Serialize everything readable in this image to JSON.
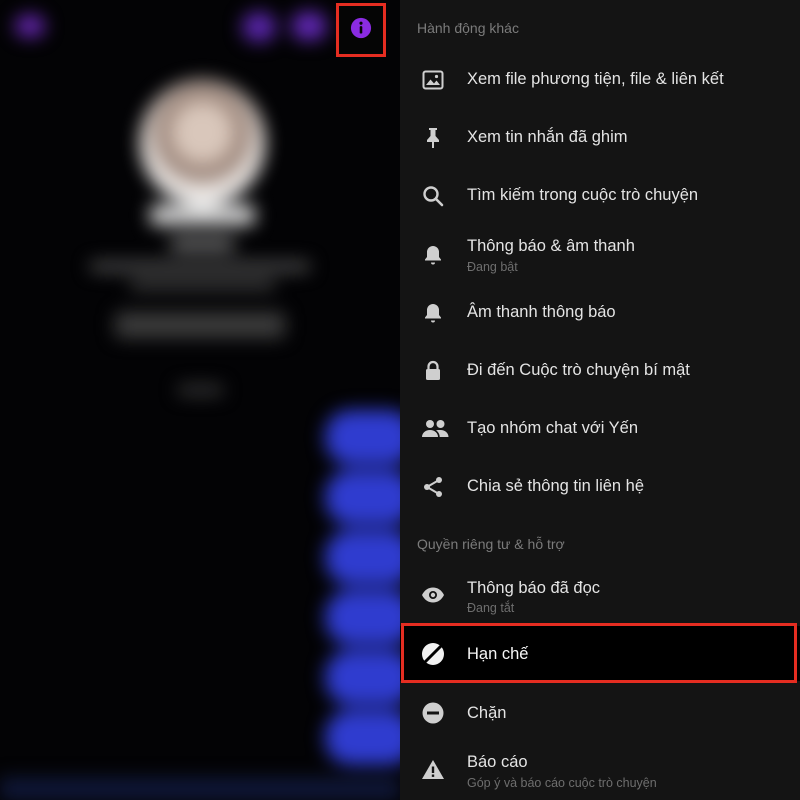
{
  "colors": {
    "accent_purple": "#8a2be2",
    "highlight_red": "#e52d21",
    "panel_bg": "#141414",
    "text_primary": "#e4e4e4",
    "text_secondary": "#7b7b7b"
  },
  "toolbar": {
    "info_icon": "info-icon"
  },
  "menu": {
    "section_more_actions": "Hành động khác",
    "section_privacy": "Quyền riêng tư & hỗ trợ",
    "items": [
      {
        "label": "Xem file phương tiện, file & liên kết",
        "icon": "image-icon"
      },
      {
        "label": "Xem tin nhắn đã ghim",
        "icon": "pin-icon"
      },
      {
        "label": "Tìm kiếm trong cuộc trò chuyện",
        "icon": "search-icon"
      },
      {
        "label": "Thông báo & âm thanh",
        "sublabel": "Đang bật",
        "icon": "bell-icon"
      },
      {
        "label": "Âm thanh thông báo",
        "icon": "bell-icon"
      },
      {
        "label": "Đi đến Cuộc trò chuyện bí mật",
        "icon": "lock-icon"
      },
      {
        "label": "Tạo nhóm chat với Yến",
        "icon": "people-icon"
      },
      {
        "label": "Chia sẻ thông tin liên hệ",
        "icon": "share-icon"
      }
    ],
    "privacy_items": [
      {
        "label": "Thông báo đã đọc",
        "sublabel": "Đang tắt",
        "icon": "eye-icon"
      },
      {
        "label": "Hạn chế",
        "icon": "restrict-icon"
      },
      {
        "label": "Chặn",
        "icon": "block-icon"
      },
      {
        "label": "Báo cáo",
        "sublabel": "Góp ý và báo cáo cuộc trò chuyện",
        "icon": "warning-icon"
      }
    ]
  }
}
